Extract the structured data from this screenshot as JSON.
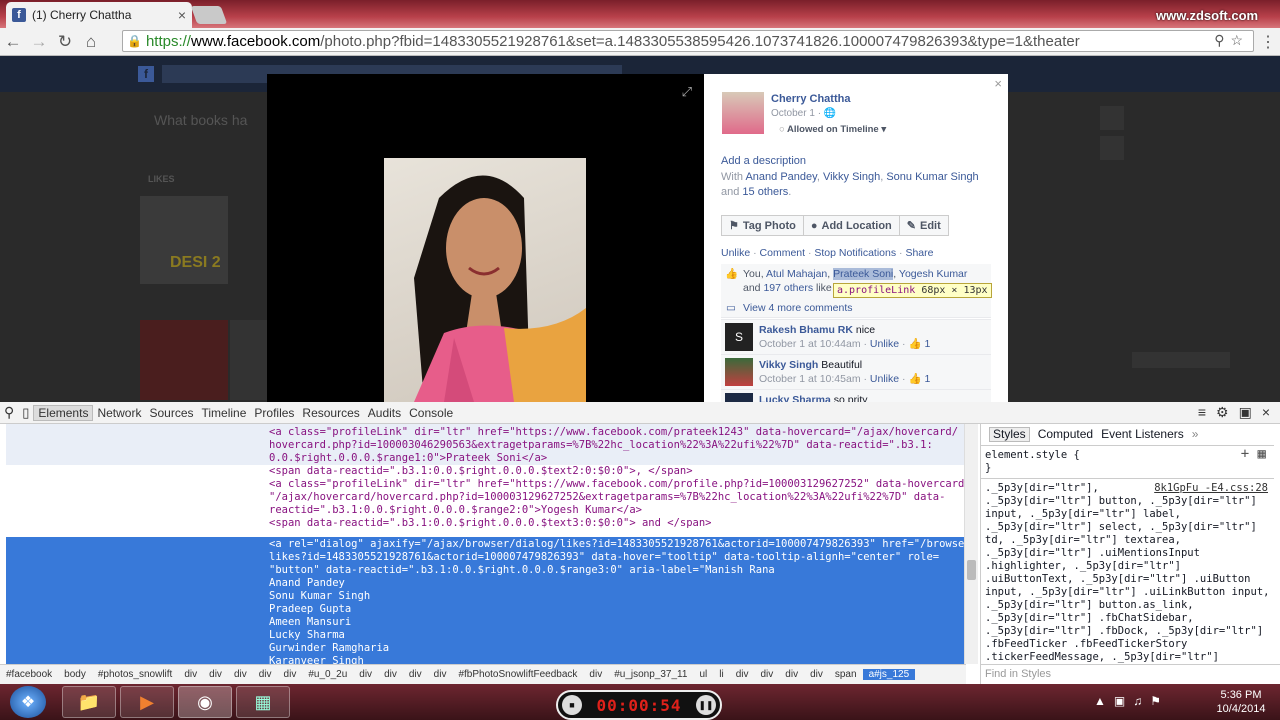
{
  "browser": {
    "tab_title": "(1) Cherry Chattha",
    "url_https": "https://",
    "url_domain": "www.facebook.com",
    "url_rest": "/photo.php?fbid=1483305521928761&set=a.1483305538595426.1073741826.100007479826393&type=1&theater",
    "watermark": "www.zdsoft.com"
  },
  "page_bg": {
    "left_prompt": "What books ha",
    "likes_label": "LIKES",
    "movie_tile": "DESI 2"
  },
  "photo_panel": {
    "author": "Cherry Chattha",
    "date": "October 1",
    "audience": "Allowed on Timeline",
    "add_description": "Add a description",
    "with_prefix": "With",
    "with_people": [
      "Anand Pandey",
      "Vikky Singh",
      "Sonu Kumar Singh"
    ],
    "with_suffix": "and",
    "with_others": "15 others",
    "tag_photo": "Tag Photo",
    "add_location": "Add Location",
    "edit": "Edit",
    "actions": [
      "Unlike",
      "Comment",
      "Stop Notifications",
      "Share"
    ],
    "likes_you": "You,",
    "likes_people": [
      "Atul Mahajan",
      "Prateek Soni",
      "Yogesh Kumar"
    ],
    "likes_and": "and",
    "likes_others": "197 others",
    "likes_suffix": "like this.",
    "tooltip_selector": "a.profileLink",
    "tooltip_size": "68px × 13px",
    "view_more": "View 4 more comments",
    "comments": [
      {
        "name": "Rakesh Bhamu RK",
        "text": "nice",
        "time": "October 1 at 10:44am",
        "unlike": "Unlike",
        "likes": "1"
      },
      {
        "name": "Vikky Singh",
        "text": "Beautiful",
        "time": "October 1 at 10:45am",
        "unlike": "Unlike",
        "likes": "1"
      },
      {
        "name": "Lucky Sharma",
        "text": "so prity",
        "time": "",
        "unlike": "",
        "likes": ""
      }
    ]
  },
  "devtools": {
    "tabs": [
      "Elements",
      "Network",
      "Sources",
      "Timeline",
      "Profiles",
      "Resources",
      "Audits",
      "Console"
    ],
    "code_lines": [
      "<a class=\"profileLink\" dir=\"ltr\" href=\"https://www.facebook.com/prateek1243\" data-hovercard=\"/ajax/hovercard/",
      "hovercard.php?id=100003046290563&extragetparams=%7B%22hc_location%22%3A%22ufi%22%7D\" data-reactid=\".b3.1:",
      "0.0.$right.0.0.0.$range1:0\">Prateek Soni</a>",
      "<span data-reactid=\".b3.1:0.0.$right.0.0.0.$text2:0:$0:0\">, </span>",
      "<a class=\"profileLink\" dir=\"ltr\" href=\"https://www.facebook.com/profile.php?id=100003129627252\" data-hovercard=",
      "\"/ajax/hovercard/hovercard.php?id=100003129627252&extragetparams=%7B%22hc_location%22%3A%22ufi%22%7D\" data-",
      "reactid=\".b3.1:0.0.$right.0.0.0.$range2:0\">Yogesh Kumar</a>",
      "<span data-reactid=\".b3.1:0.0.$right.0.0.0.$text3:0:$0:0\"> and </span>"
    ],
    "selected_lines": [
      "<a rel=\"dialog\" ajaxify=\"/ajax/browser/dialog/likes?id=1483305521928761&actorid=100007479826393\" href=\"/browse/",
      "likes?id=1483305521928761&actorid=100007479826393\" data-hover=\"tooltip\" data-tooltip-alignh=\"center\" role=",
      "\"button\" data-reactid=\".b3.1:0.0.$right.0.0.0.$range3:0\" aria-label=\"Manish Rana",
      "Anand Pandey",
      "Sonu Kumar Singh",
      "Pradeep Gupta",
      "Ameen Mansuri",
      "Lucky Sharma",
      "Gurwinder Ramgharia",
      "Karanveer Singh"
    ],
    "styles_tabs": [
      "Styles",
      "Computed",
      "Event Listeners"
    ],
    "element_style": "element.style {",
    "element_style_close": "}",
    "rule_source": "8k1GpFu -E4.css:28",
    "rule_lines": [
      "._5p3y[dir=\"ltr\"],",
      "._5p3y[dir=\"ltr\"] button, ._5p3y[dir=\"ltr\"]",
      "input, ._5p3y[dir=\"ltr\"] label,",
      "._5p3y[dir=\"ltr\"] select, ._5p3y[dir=\"ltr\"]",
      "td, ._5p3y[dir=\"ltr\"] textarea,",
      "._5p3y[dir=\"ltr\"] .uiMentionsInput",
      ".highlighter, ._5p3y[dir=\"ltr\"]",
      ".uiButtonText, ._5p3y[dir=\"ltr\"] .uiButton",
      "input, ._5p3y[dir=\"ltr\"] .uiLinkButton input,",
      "._5p3y[dir=\"ltr\"] button.as_link,",
      "._5p3y[dir=\"ltr\"] .fbChatSidebar,",
      "._5p3y[dir=\"ltr\"] .fbDock, ._5p3y[dir=\"ltr\"]",
      ".fbFeedTicker .fbFeedTickerStory",
      ".tickerFeedMessage, ._5p3y[dir=\"ltr\"]"
    ],
    "breadcrumbs": [
      "#facebook",
      "body",
      "#photos_snowlift",
      "div",
      "div",
      "div",
      "div",
      "div",
      "#u_0_2u",
      "div",
      "div",
      "div",
      "div",
      "#fbPhotoSnowliftFeedback",
      "div",
      "#u_jsonp_37_11",
      "ul",
      "li",
      "div",
      "div",
      "div",
      "div",
      "span",
      "a#js_125"
    ],
    "find_in_styles": "Find in Styles"
  },
  "taskbar": {
    "recorder_time": "00:00:54",
    "time": "5:36 PM",
    "date": "10/4/2014"
  }
}
